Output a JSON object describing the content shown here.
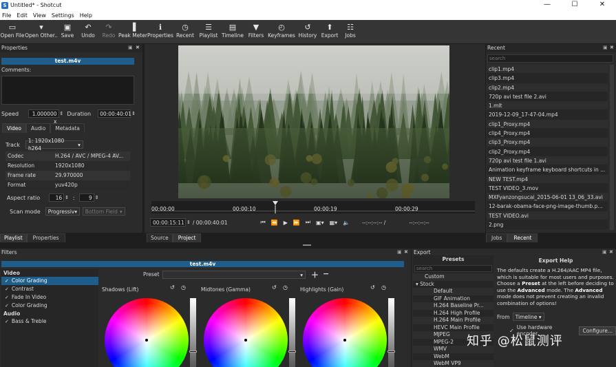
{
  "window": {
    "title": "Untitled* - Shotcut",
    "controls": [
      "—",
      "☐",
      "✕"
    ]
  },
  "menu": [
    "File",
    "Edit",
    "View",
    "Settings",
    "Help"
  ],
  "toolbar": [
    {
      "label": "Open File",
      "icon": "▭",
      "name": "open-file"
    },
    {
      "label": "Open Other..",
      "icon": "▾",
      "name": "open-other"
    },
    {
      "label": "Save",
      "icon": "▣",
      "name": "save"
    },
    {
      "label": "Undo",
      "icon": "↶",
      "name": "undo"
    },
    {
      "label": "Redo",
      "icon": "↷",
      "name": "redo",
      "disabled": true
    },
    {
      "label": "Peak Meter",
      "icon": "▐",
      "name": "peak-meter"
    },
    {
      "label": "Properties",
      "icon": "ℹ",
      "name": "properties"
    },
    {
      "label": "Recent",
      "icon": "◷",
      "name": "recent"
    },
    {
      "label": "Playlist",
      "icon": "☰",
      "name": "playlist"
    },
    {
      "label": "Timeline",
      "icon": "▤",
      "name": "timeline"
    },
    {
      "label": "Filters",
      "icon": "▼",
      "name": "filters"
    },
    {
      "label": "Keyframes",
      "icon": "◴",
      "name": "keyframes"
    },
    {
      "label": "History",
      "icon": "↺",
      "name": "history"
    },
    {
      "label": "Export",
      "icon": "⬆",
      "name": "export"
    },
    {
      "label": "Jobs",
      "icon": "☷",
      "name": "jobs"
    }
  ],
  "properties": {
    "title": "Properties",
    "filename": "test.m4v",
    "comments_label": "Comments:",
    "speed_label": "Speed",
    "speed_value": "1.000000 x",
    "duration_label": "Duration",
    "duration_value": "00:00:40:01",
    "tabs": [
      "Video",
      "Audio",
      "Metadata"
    ],
    "track_label": "Track",
    "track_value": "1: 1920x1080 h264",
    "rows": [
      {
        "k": "Codec",
        "v": "H.264 / AVC / MPEG-4 AV..."
      },
      {
        "k": "Resolution",
        "v": "1920x1080"
      },
      {
        "k": "Frame rate",
        "v": "29.970000"
      },
      {
        "k": "Format",
        "v": "yuv420p"
      }
    ],
    "aspect_label": "Aspect ratio",
    "aspect_num": "16",
    "aspect_sep": ":",
    "aspect_den": "9",
    "scan_label": "Scan mode",
    "scan_value": "Progressiv",
    "field_value": "Bottom Field"
  },
  "player": {
    "ticks": [
      "00:00:00",
      "00:00:10",
      "00:00:19",
      "00:00:29"
    ],
    "position": "00:00:15:11",
    "total": "/ 00:00:40:01",
    "in_point": "--:--:--:-- /",
    "out_point": "--:--:--:--",
    "tabs": [
      "Source",
      "Project"
    ]
  },
  "recent": {
    "title": "Recent",
    "search_placeholder": "search",
    "items": [
      "clip1.mp4",
      "clip3.mp4",
      "clip2.mp4",
      "720p avi test file 2.avi",
      "1.mlt",
      "2019-12-09_17-47-04.mp4",
      "clip1_Proxy.mp4",
      "clip4_Proxy.mp4",
      "clip3_Proxy.mp4",
      "clip2_Proxy.mp4",
      "720p avi test file 1.avi",
      "Animation keyframe keyboard shortcuts in ...",
      "NEW TEST.mp4",
      "TEST VIDEO_3.mov",
      "MXFyanzongsucai_2015-06-01 13_06_33.avi",
      "12-barak-obama-face-png-image-thumb.p...",
      "TEST VIDEO.avi",
      "2.png"
    ],
    "tabs": [
      "Jobs",
      "Recent"
    ]
  },
  "left_tabs": [
    "Playlist",
    "Properties"
  ],
  "filters": {
    "title": "Filters",
    "filename": "test.m4v",
    "sections": [
      {
        "name": "Video",
        "items": [
          {
            "label": "Color Grading",
            "selected": true
          },
          {
            "label": "Contrast"
          },
          {
            "label": "Fade In Video"
          },
          {
            "label": "Color Grading"
          }
        ]
      },
      {
        "name": "Audio",
        "items": [
          {
            "label": "Bass & Treble"
          }
        ]
      }
    ],
    "preset_label": "Preset",
    "wheels": [
      {
        "label": "Shadows (Lift)",
        "slider": 0.62
      },
      {
        "label": "Midtones (Gamma)",
        "slider": 0.62
      },
      {
        "label": "Highlights (Gain)",
        "slider": 0.62
      }
    ]
  },
  "export": {
    "title": "Export",
    "presets_title": "Presets",
    "search_placeholder": "search",
    "presets": [
      {
        "label": "Custom",
        "lvl": "lvl0"
      },
      {
        "label": "▾  Stock",
        "lvl": "lvl0s"
      },
      {
        "label": "Default",
        "lvl": "lvl1"
      },
      {
        "label": "GIF Animation",
        "lvl": "lvl1"
      },
      {
        "label": "H.264 Baseline Pr...",
        "lvl": "lvl1"
      },
      {
        "label": "H.264 High Profile",
        "lvl": "lvl1"
      },
      {
        "label": "H.264 Main Profile",
        "lvl": "lvl1"
      },
      {
        "label": "HEVC Main Profile",
        "lvl": "lvl1"
      },
      {
        "label": "MJPEG",
        "lvl": "lvl1"
      },
      {
        "label": "MPEG-2",
        "lvl": "lvl1"
      },
      {
        "label": "WMV",
        "lvl": "lvl1"
      },
      {
        "label": "WebM",
        "lvl": "lvl1"
      },
      {
        "label": "WebM VP9",
        "lvl": "lvl1"
      }
    ],
    "help_title": "Export Help",
    "help_1": "The defaults create a H.264/AAC MP4 file, which is suitable for most users and purposes. Choose a ",
    "help_b1": "Preset",
    "help_2": " at the left before deciding to use the ",
    "help_b2": "Advanced",
    "help_3": " mode. The ",
    "help_b3": "Advanced",
    "help_4": " mode does not prevent creating an invalid combination of options!",
    "from_label": "From",
    "from_value": "Timeline",
    "hw_label": "Use hardware encoder",
    "configure_label": "Configure..."
  },
  "watermark": "知乎 @松鼠测评"
}
